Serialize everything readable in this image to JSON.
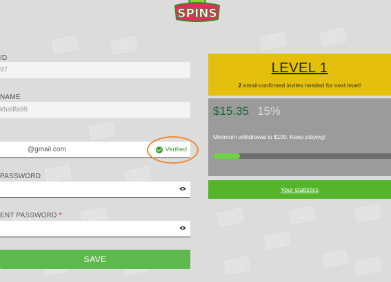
{
  "colors": {
    "accent_green": "#5eb94d",
    "level_yellow": "#e5bf0d",
    "balance_green": "#17632f",
    "verified_green": "#3c9b2c",
    "highlight_orange": "#ef8a2e",
    "required_red": "#e0242c"
  },
  "logo": {
    "text": "SPINS"
  },
  "form": {
    "id_label": "ID",
    "id_value": "97",
    "name_label": "NAME",
    "name_value": "khalifa99",
    "email_value": "@gmail.com",
    "email_status": "Verified",
    "password_label": "PASSWORD",
    "current_password_label": "ENT PASSWORD",
    "required_marker": "*",
    "save_label": "SAVE"
  },
  "level": {
    "title": "LEVEL 1",
    "invites_count": "2",
    "invites_text": "email-confirmed invites needed for next level!"
  },
  "balance": {
    "amount": "$15.35",
    "percent_text": "15%",
    "progress_fraction": 0.15,
    "note": "Minimum withdrawal is $100. Keep playing!"
  },
  "stats": {
    "link_label": "Your statistics"
  },
  "icons": {
    "eye": "eye-icon",
    "check": "check-circle-icon"
  }
}
